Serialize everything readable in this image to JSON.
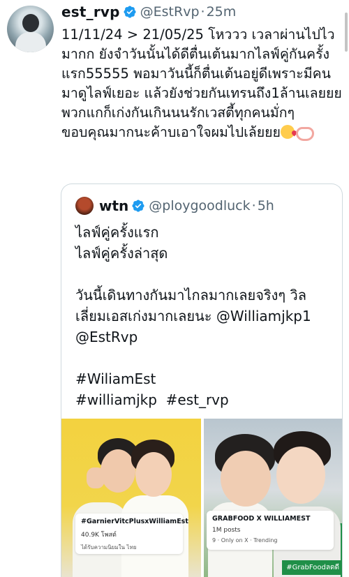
{
  "tweet": {
    "display_name": "est_rvp",
    "handle": "@EstRvp",
    "separator": "·",
    "time": "25m",
    "text": "11/11/24 > 21/05/25 โหววว เวลาผ่านไปไวมากก ยังจำวันนั้นได้ดีตื่นเต้นมากไลฟ์คู่กันครั้งแรก55555 พอมาวันนี้ก็ตื่นเต้นอยู่ดีเพราะมีคนมาดูไลฟ์เยอะ แล้วยังช่วยกันเทรนถึง1ล้านเลยยย  พวกแกก็เก่งกันเกินนนรักเวสตี้ทุกคนมั่กๆ ขอบคุณมากนะค้าบเอาใจผมไปเล้ยยย"
  },
  "quoted": {
    "display_name": "wtn",
    "handle": "@ploygoodluck",
    "separator": "·",
    "time": "5h",
    "lines": [
      "ไลฟ์คู่ครั้งแรก",
      "ไลฟ์คู่ครั้งล่าสุด",
      "",
      "วันนี้เดินทางกันมาไกลมากเลยจริงๆ วิล",
      "เลี่ยมเอสเก่งมากเลยนะ @Williamjkp1",
      "@EstRvp",
      "",
      "#WiliamEst",
      "#williamjkp  #est_rvp"
    ],
    "media": [
      {
        "caption_title": "#GarnierVitcPlusxWilliamEst",
        "caption_sub": "40.9K โพสต์",
        "caption_sub2": "ได้รับความนิยมใน ไทย"
      },
      {
        "caption_title": "GRABFOOD X WILLIAMEST",
        "caption_sub": "1M posts",
        "caption_sub2": "9 · Only on X · Trending",
        "tag": "#GrabFoodลดดี"
      }
    ]
  },
  "colors": {
    "verified": "#1d9bf0",
    "muted": "#536471",
    "border": "#cfd9de",
    "grab_green": "#1f8f48"
  },
  "icons": [
    "verified-badge-icon",
    "kissing-face-emoji",
    "heart-hands-emoji"
  ]
}
